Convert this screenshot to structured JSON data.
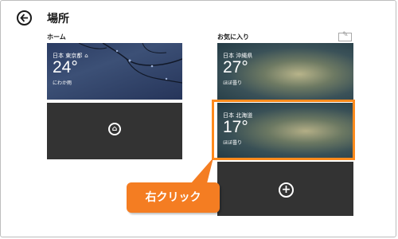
{
  "header": {
    "title": "場所",
    "back_icon": "back-arrow-icon"
  },
  "sections": {
    "home_label": "ホーム",
    "favorites_label": "お気に入り",
    "edit_icon": "pencil-icon"
  },
  "tiles": {
    "home": {
      "location": "日本 東京都",
      "temp": "24°",
      "condition": "にわか雨",
      "home_icon": "home-icon"
    },
    "okinawa": {
      "location": "日本 沖縄県",
      "temp": "27°",
      "condition": "ほぼ曇り"
    },
    "hokkaido": {
      "location": "日本 北海道",
      "temp": "17°",
      "condition": "ほぼ曇り"
    },
    "add_home_icon": "set-home-icon",
    "add_favorite_icon": "plus-circle-icon"
  },
  "annotation": {
    "callout": "右クリック",
    "highlight_color": "#ff8a1c",
    "callout_color": "#f47d22"
  }
}
